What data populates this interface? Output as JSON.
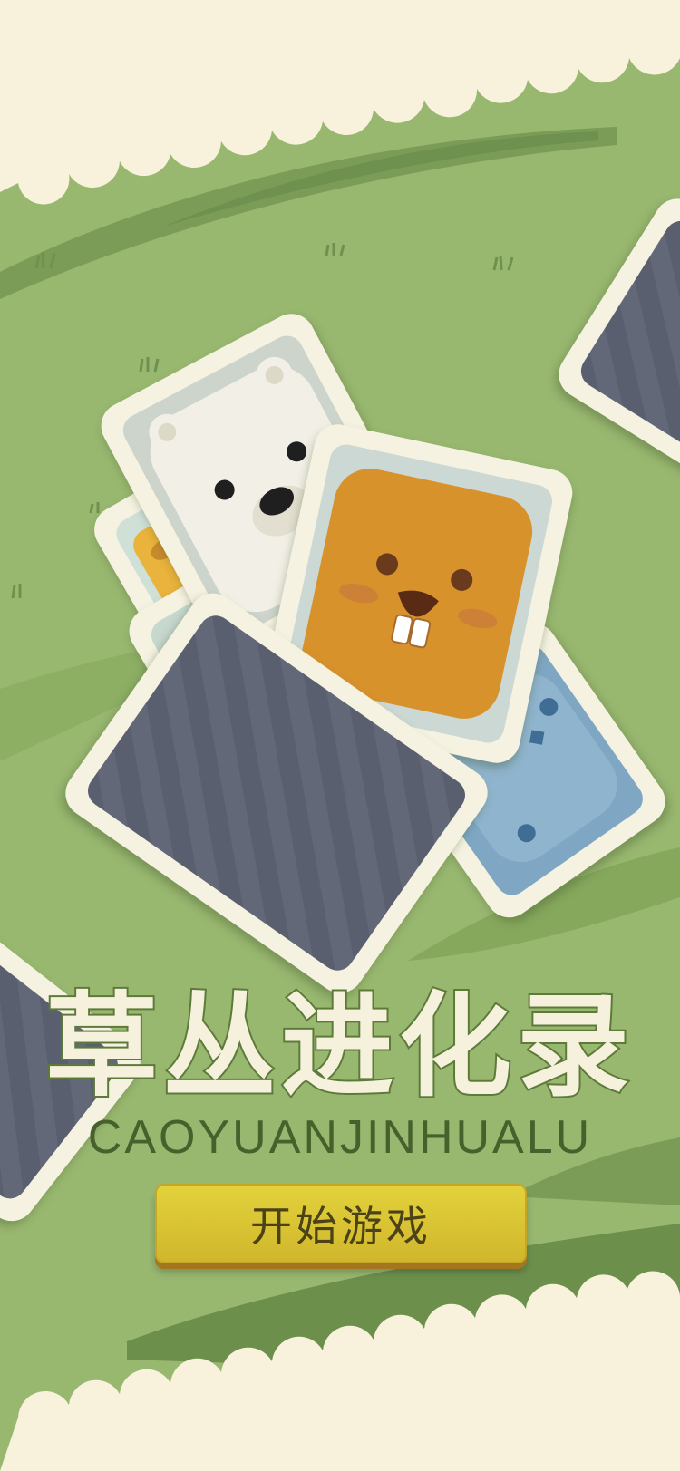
{
  "game": {
    "title": "草丛进化录",
    "subtitle": "CAOYUANJINHUALU",
    "start_button_label": "开始游戏"
  },
  "cards": [
    {
      "face": "card-back"
    },
    {
      "face": "polar-bear"
    },
    {
      "face": "giraffe",
      "partially_hidden": true
    },
    {
      "face": "beaver"
    },
    {
      "face": "blue-animal",
      "partially_hidden": true
    },
    {
      "face": "card-back"
    },
    {
      "face": "card-back"
    }
  ],
  "colors": {
    "grass": "#98b76f",
    "grass_dark": "#7a9c56",
    "cloud": "#f8f2dc",
    "card_frame": "#f5f2e1",
    "card_back": "#5a5f70",
    "title_fill": "#f6f1dc",
    "title_outline": "#5d7a3a",
    "subtitle": "#47612c",
    "button": "#dcc534"
  }
}
